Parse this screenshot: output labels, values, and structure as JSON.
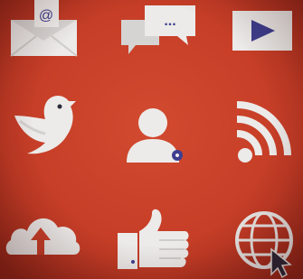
{
  "palette": {
    "background": "#c8402a",
    "icon_fill": "#ecebe9",
    "icon_shade": "#d6d4d2",
    "accent_blue": "#3d3e8f",
    "dark_outline": "#2a2a3a"
  },
  "icons": [
    {
      "name": "email-envelope-icon",
      "glyph": "@"
    },
    {
      "name": "chat-bubbles-icon",
      "glyph": "..."
    },
    {
      "name": "video-play-icon"
    },
    {
      "name": "twitter-bird-icon"
    },
    {
      "name": "user-profile-icon"
    },
    {
      "name": "rss-feed-icon"
    },
    {
      "name": "cloud-upload-icon"
    },
    {
      "name": "thumbs-up-icon"
    },
    {
      "name": "globe-cursor-icon"
    }
  ]
}
